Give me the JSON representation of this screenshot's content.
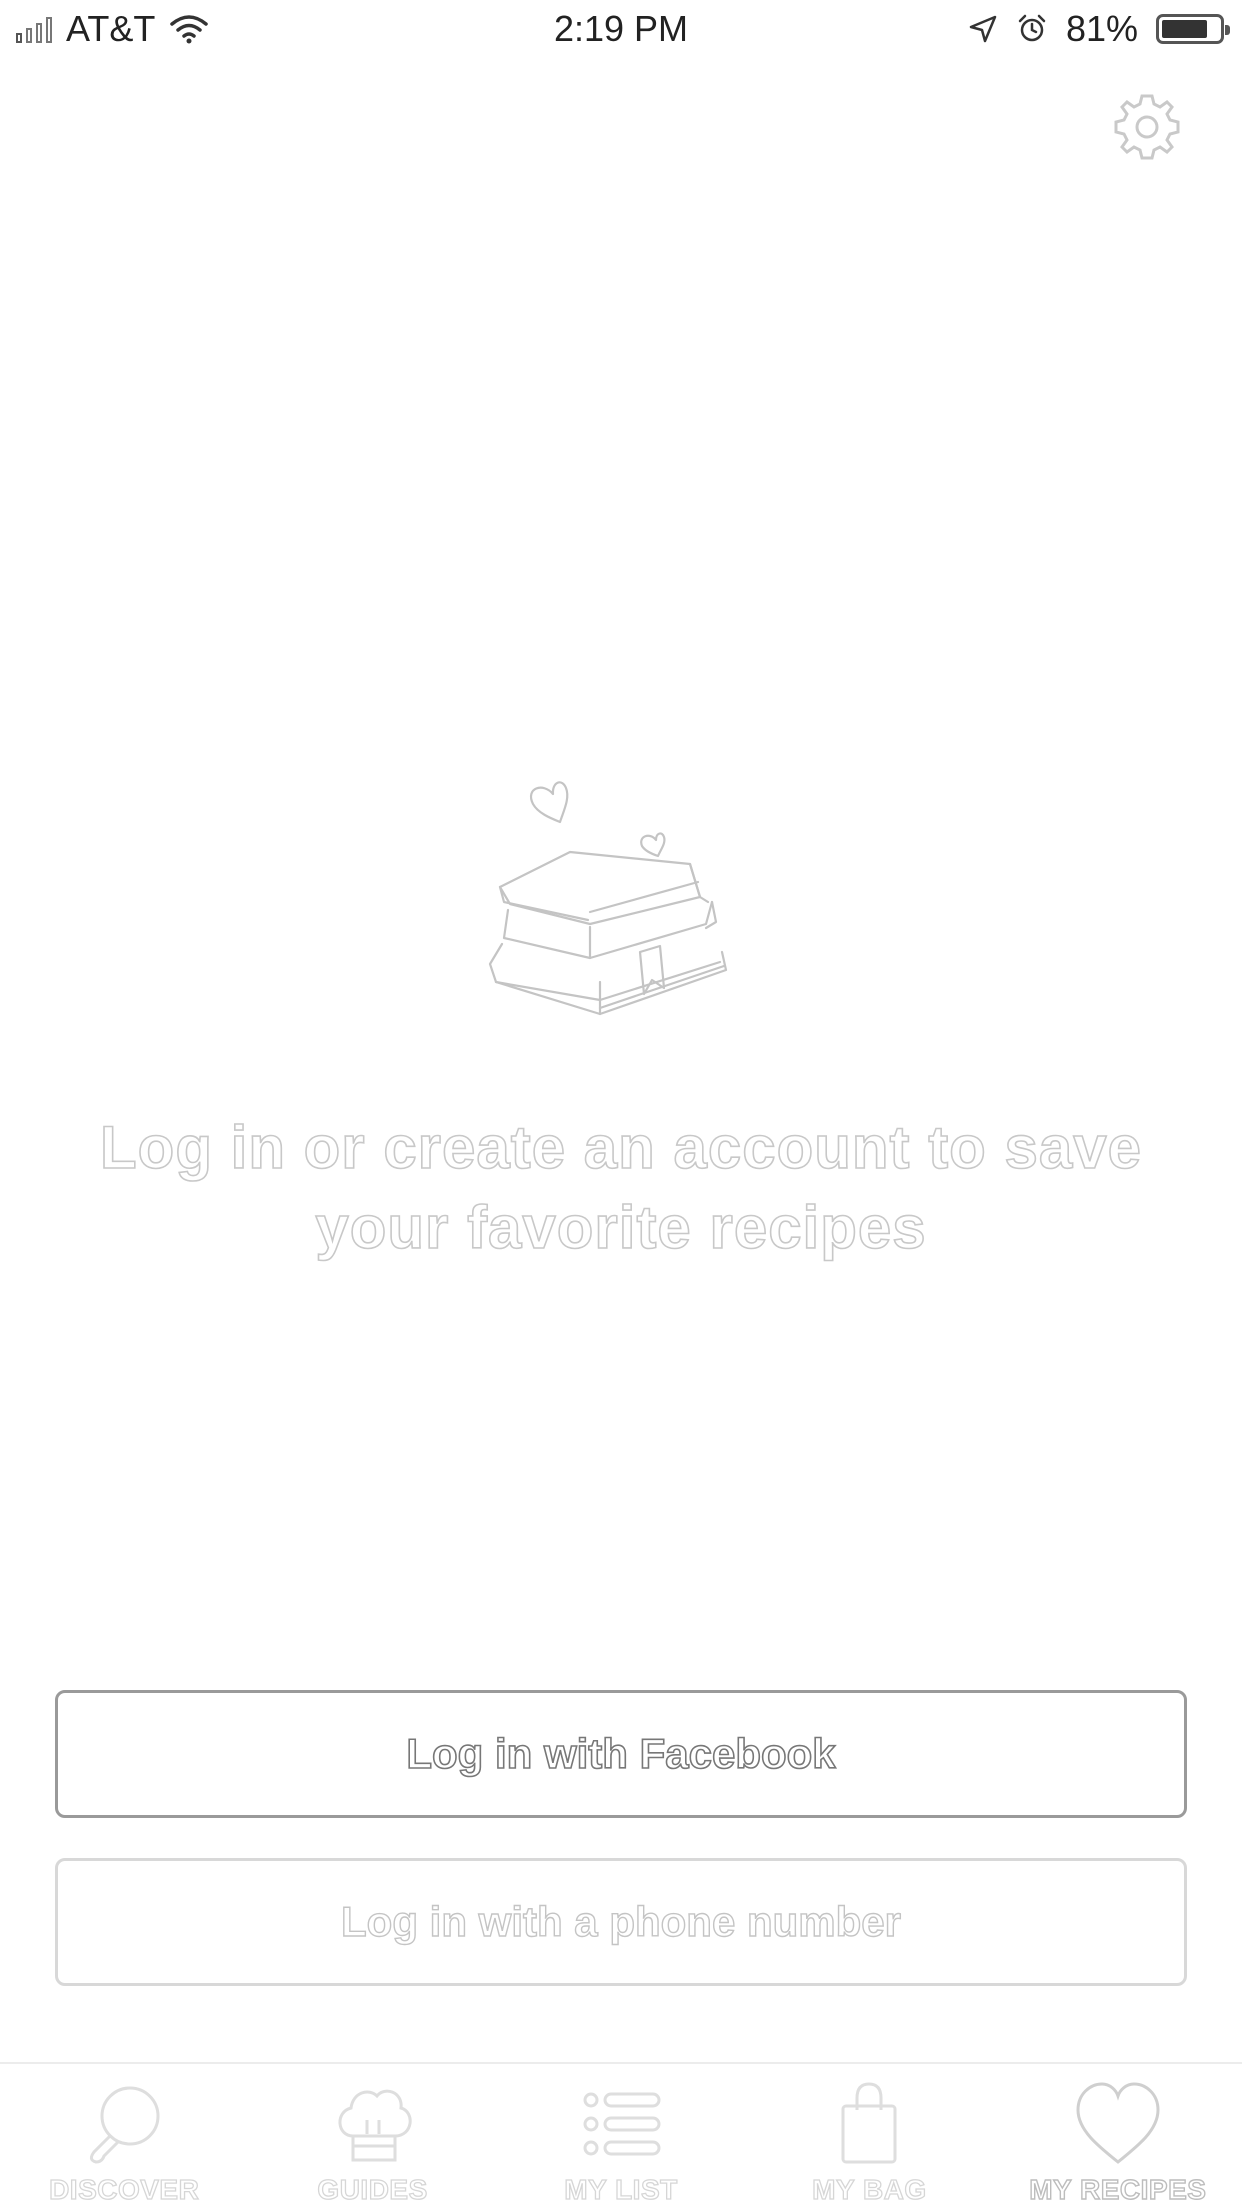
{
  "status_bar": {
    "carrier": "AT&T",
    "time": "2:19 PM",
    "battery_percent": "81%",
    "battery_level": 0.81,
    "icons": [
      "signal-icon",
      "wifi-icon",
      "location-arrow-icon",
      "alarm-icon",
      "battery-icon"
    ]
  },
  "header": {
    "settings_icon": "gear-icon"
  },
  "empty_state": {
    "illustration": "book-stack-with-hearts",
    "message_line1": "Log in or create an account to save",
    "message_line2": "your favorite recipes"
  },
  "actions": {
    "facebook_label": "Log in with Facebook",
    "phone_label": "Log in with a phone number"
  },
  "tabbar": {
    "tabs": [
      {
        "label": "DISCOVER",
        "icon": "search-icon"
      },
      {
        "label": "GUIDES",
        "icon": "chef-hat-icon"
      },
      {
        "label": "MY LIST",
        "icon": "list-icon"
      },
      {
        "label": "MY BAG",
        "icon": "shopping-bag-icon"
      },
      {
        "label": "MY RECIPES",
        "icon": "heart-icon"
      }
    ],
    "active": "MY RECIPES"
  },
  "colors": {
    "background": "#ffffff",
    "outline_text": "#c8c8c8",
    "facebook_border": "#9a9a9a",
    "phone_border": "#d8d8d8"
  }
}
